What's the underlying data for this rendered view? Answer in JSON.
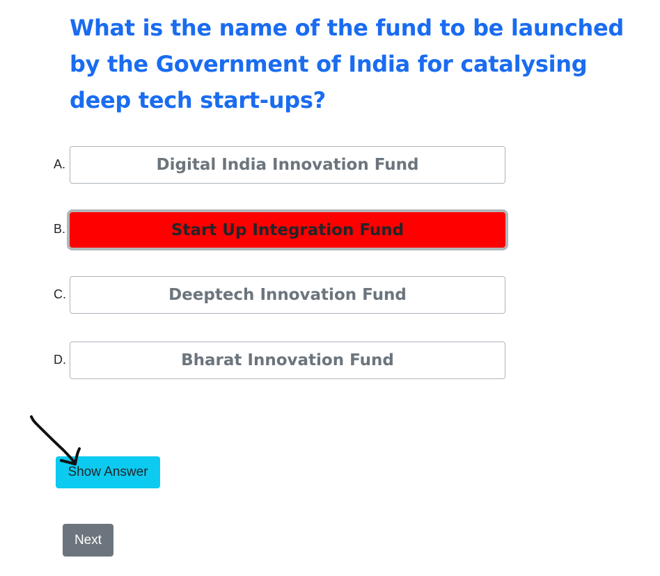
{
  "question": {
    "text": "What is the name of the fund to be launched by the Government of India for catalysing deep tech start-ups?"
  },
  "options": [
    {
      "letter": "A.",
      "label": "Digital India Innovation Fund",
      "selected": false
    },
    {
      "letter": "B.",
      "label": "Start Up Integration Fund",
      "selected": true
    },
    {
      "letter": "C.",
      "label": "Deeptech Innovation Fund",
      "selected": false
    },
    {
      "letter": "D.",
      "label": "Bharat Innovation Fund",
      "selected": false
    }
  ],
  "actions": {
    "show_answer_label": "Show Answer",
    "next_label": "Next"
  },
  "colors": {
    "question_text": "#1a6cf0",
    "selected_option_bg": "#ff0000",
    "show_answer_bg": "#0dcaf0",
    "next_bg": "#6c757d"
  },
  "annotation": {
    "icon": "hand-drawn-arrow-icon",
    "color": "#111111"
  }
}
